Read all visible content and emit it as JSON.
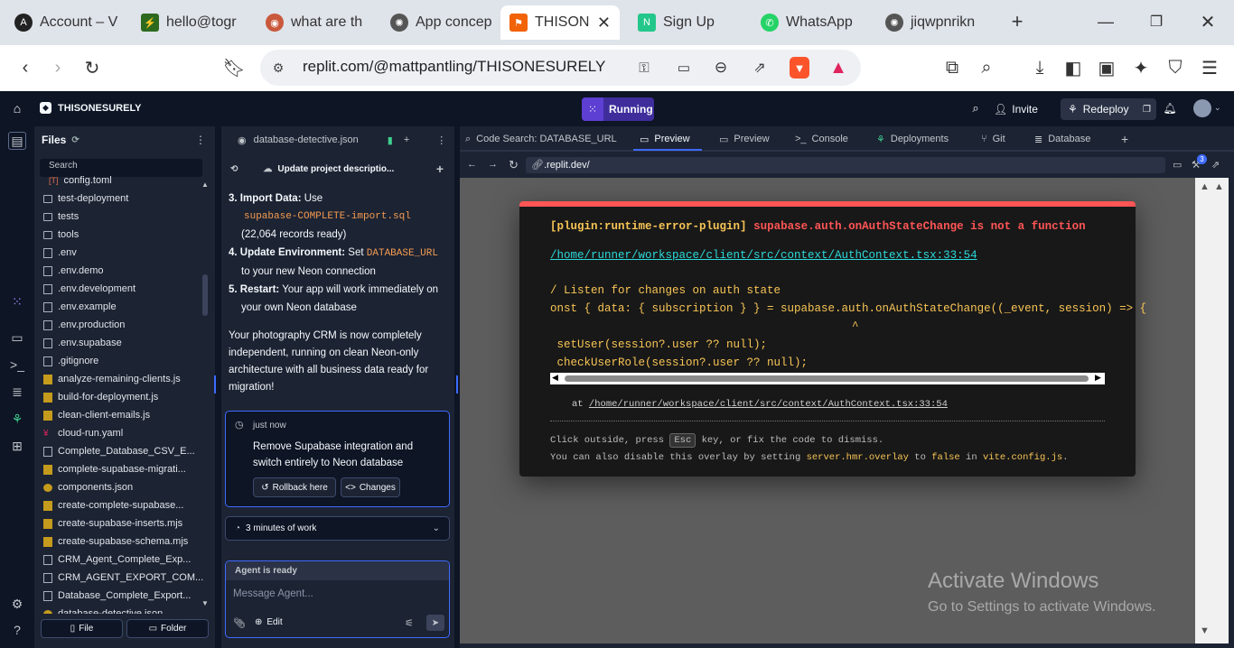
{
  "browser": {
    "tabs": [
      {
        "label": "Account – V",
        "fav": "A"
      },
      {
        "label": "hello@togr",
        "fav": "⚡"
      },
      {
        "label": "what are th",
        "fav": "◉"
      },
      {
        "label": "App concep",
        "fav": "✺"
      },
      {
        "label": "THISON",
        "fav": "⚑"
      },
      {
        "label": "Sign Up",
        "fav": "N"
      },
      {
        "label": "WhatsApp",
        "fav": "✆"
      },
      {
        "label": "jiqwpnrikn",
        "fav": "✺"
      }
    ],
    "url": "replit.com/@mattpantling/THISONESURELY"
  },
  "replit": {
    "project_name": "THISONESURELY",
    "run_status": "Running",
    "invite_label": "Invite",
    "redeploy_label": "Redeploy"
  },
  "files": {
    "title": "Files",
    "search_label": "Search",
    "items": [
      {
        "name": "config.toml",
        "icon": "toml"
      },
      {
        "name": "test-deployment",
        "icon": "folder"
      },
      {
        "name": "tests",
        "icon": "folder"
      },
      {
        "name": "tools",
        "icon": "folder"
      },
      {
        "name": ".env",
        "icon": "doc"
      },
      {
        "name": ".env.demo",
        "icon": "doc"
      },
      {
        "name": ".env.development",
        "icon": "doc"
      },
      {
        "name": ".env.example",
        "icon": "doc"
      },
      {
        "name": ".env.production",
        "icon": "doc"
      },
      {
        "name": ".env.supabase",
        "icon": "doc"
      },
      {
        "name": ".gitignore",
        "icon": "doc"
      },
      {
        "name": "analyze-remaining-clients.js",
        "icon": "js"
      },
      {
        "name": "build-for-deployment.js",
        "icon": "js"
      },
      {
        "name": "clean-client-emails.js",
        "icon": "js"
      },
      {
        "name": "cloud-run.yaml",
        "icon": "yaml"
      },
      {
        "name": "Complete_Database_CSV_E...",
        "icon": "doc"
      },
      {
        "name": "complete-supabase-migrati...",
        "icon": "js"
      },
      {
        "name": "components.json",
        "icon": "json"
      },
      {
        "name": "create-complete-supabase...",
        "icon": "js"
      },
      {
        "name": "create-supabase-inserts.mjs",
        "icon": "js"
      },
      {
        "name": "create-supabase-schema.mjs",
        "icon": "js"
      },
      {
        "name": "CRM_Agent_Complete_Exp...",
        "icon": "doc"
      },
      {
        "name": "CRM_AGENT_EXPORT_COM...",
        "icon": "md"
      },
      {
        "name": "Database_Complete_Export...",
        "icon": "doc"
      },
      {
        "name": "database-detective.json",
        "icon": "json"
      }
    ],
    "new_file_label": "File",
    "new_folder_label": "Folder"
  },
  "agent": {
    "tab_label": "database-detective.json",
    "header_label": "Update project descriptio...",
    "step3_bold": "Import Data:",
    "step3_text": "Use",
    "step3_code": "supabase-COMPLETE-import.sql",
    "step3_note": "(22,064 records ready)",
    "step4_bold": "Update Environment:",
    "step4_text": "Set",
    "step4_code": "DATABASE_URL",
    "step4_note": "to your new Neon connection",
    "step5_bold": "Restart:",
    "step5_text": "Your app will work immediately on",
    "step5_note": "your own Neon database",
    "n3": "3.",
    "n4": "4.",
    "n5": "5.",
    "summary": "Your photography CRM is now completely independent, running on clean Neon-only architecture with all business data ready for migration!",
    "checkpoint_time": "just now",
    "checkpoint_text": "Remove Supabase integration and switch entirely to Neon database",
    "rollback_label": "Rollback here",
    "changes_label": "Changes",
    "work_label": "3 minutes of work",
    "status": "Agent is ready",
    "placeholder": "Message Agent...",
    "edit_label": "Edit"
  },
  "preview": {
    "tabs": [
      {
        "label": "Code Search: DATABASE_URL",
        "icon": "search-icon"
      },
      {
        "label": "Preview",
        "icon": "monitor-icon",
        "active": true
      },
      {
        "label": "Preview",
        "icon": "monitor-icon"
      },
      {
        "label": "Console",
        "icon": "terminal-icon"
      },
      {
        "label": "Deployments",
        "icon": "deploy-icon"
      },
      {
        "label": "Git",
        "icon": "git-icon"
      },
      {
        "label": "Database",
        "icon": "database-icon"
      }
    ],
    "url": ".replit.dev/",
    "badge": "3"
  },
  "error": {
    "plugin": "[plugin:runtime-error-plugin]",
    "message": "supabase.auth.onAuthStateChange is not a function",
    "file": "/home/runner/workspace/client/src/context/AuthContext.tsx:33:54",
    "line1": "/ Listen for changes on auth state",
    "line2": "onst { data: { subscription } } = supabase.auth.onAuthStateChange((_event, session) => {",
    "line3": "^",
    "line4": " setUser(session?.user ?? null);",
    "line5": " checkUserRole(session?.user ?? null);",
    "at": "at",
    "at_file": "/home/runner/workspace/client/src/context/AuthContext.tsx:33:54",
    "tip1_a": "Click outside, press",
    "tip1_key": "Esc",
    "tip1_b": "key, or fix the code to dismiss.",
    "tip2_a": "You can also disable this overlay by setting",
    "tip2_code1": "server.hmr.overlay",
    "tip2_b": "to",
    "tip2_code2": "false",
    "tip2_c": "in",
    "tip2_code3": "vite.config.js",
    "tip2_d": "."
  },
  "watermark": {
    "title": "Activate Windows",
    "subtitle": "Go to Settings to activate Windows."
  },
  "colors": {
    "bg": "#0e1525",
    "panel": "#1c2333",
    "accent": "#5d3fd3",
    "error": "#ff5555",
    "code": "#f8c555"
  }
}
